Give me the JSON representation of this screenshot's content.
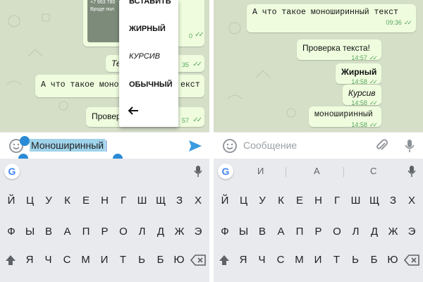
{
  "left": {
    "image_message": {
      "line1": "+7 963 780",
      "line2": "Вроде пол",
      "time": "0"
    },
    "messages": [
      {
        "text": "Те",
        "time": "35"
      },
      {
        "text": "А что такое моно",
        "text2": "екст",
        "time": ""
      },
      {
        "text": "Провер",
        "time": "57"
      }
    ],
    "context_menu": {
      "paste": "ВСТАВИТЬ",
      "bold": "ЖИРНЫЙ",
      "italic": "КУРСИВ",
      "normal": "ОБЫЧНЫЙ"
    },
    "input": {
      "value": "Моноширинный"
    }
  },
  "right": {
    "messages": [
      {
        "text": "А что такое моноширинный текст",
        "time": "09:36"
      },
      {
        "text": "Проверка текста!",
        "time": "14:57"
      },
      {
        "text": "Жирный",
        "time": "14:58"
      },
      {
        "text": "Курсив",
        "time": "14:58"
      },
      {
        "text": "моноширинный",
        "time": "14:58"
      }
    ],
    "input": {
      "placeholder": "Сообщение"
    },
    "suggestions": [
      "И",
      "А",
      "С"
    ]
  },
  "keyboard": {
    "row1": [
      "Й",
      "Ц",
      "У",
      "К",
      "Е",
      "Н",
      "Г",
      "Ш",
      "Щ",
      "З",
      "Х"
    ],
    "row2": [
      "Ф",
      "Ы",
      "В",
      "А",
      "П",
      "Р",
      "О",
      "Л",
      "Д",
      "Ж",
      "Э"
    ],
    "row3": [
      "Я",
      "Ч",
      "С",
      "М",
      "И",
      "Т",
      "Ь",
      "Б",
      "Ю"
    ]
  },
  "colors": {
    "chat_bg": "#d5dfc8",
    "bubble": "#effdde",
    "check": "#59a65f",
    "accent": "#2a8ad6",
    "keyboard_bg": "#e8eaed"
  },
  "icons": [
    "emoji-icon",
    "send-icon",
    "attach-icon",
    "mic-icon",
    "google-icon",
    "back-arrow-icon",
    "shift-icon",
    "backspace-icon"
  ]
}
